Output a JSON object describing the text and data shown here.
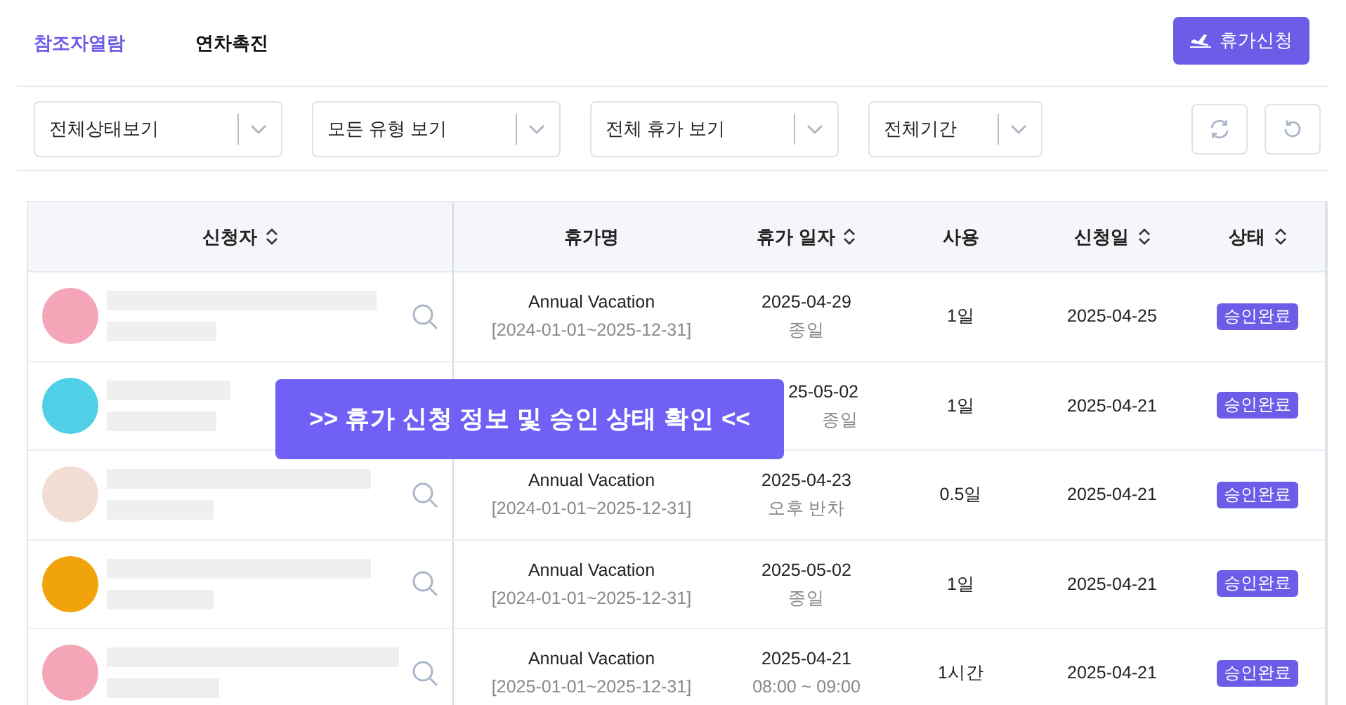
{
  "tabs": [
    {
      "label": "참조자열람",
      "selected": true
    },
    {
      "label": "연차촉진",
      "selected": false
    }
  ],
  "request_button": {
    "label": "휴가신청"
  },
  "filters": [
    {
      "label": "전체상태보기"
    },
    {
      "label": "모든 유형 보기"
    },
    {
      "label": "전체 휴가 보기"
    },
    {
      "label": "전체기간"
    }
  ],
  "table": {
    "columns": [
      {
        "label": "신청자",
        "sortable": true
      },
      {
        "label": "휴가명",
        "sortable": false
      },
      {
        "label": "휴가 일자",
        "sortable": true
      },
      {
        "label": "사용",
        "sortable": false
      },
      {
        "label": "신청일",
        "sortable": true
      },
      {
        "label": "상태",
        "sortable": true
      }
    ],
    "rows": [
      {
        "color": "#f4a6b8",
        "vacation_name": "Annual Vacation",
        "period": "[2024-01-01~2025-12-31]",
        "date": "2025-04-29",
        "date_detail": "종일",
        "usage": "1일",
        "applied_date": "2025-04-25",
        "status": "승인완료"
      },
      {
        "color": "#4fd0e6",
        "date": "25-05-02",
        "date_detail": "종일",
        "usage": "1일",
        "applied_date": "2025-04-21",
        "status": "승인완료"
      },
      {
        "color": "#f1ddd2",
        "vacation_name": "Annual Vacation",
        "period": "[2024-01-01~2025-12-31]",
        "date": "2025-04-23",
        "date_detail": "오후 반차",
        "usage": "0.5일",
        "applied_date": "2025-04-21",
        "status": "승인완료"
      },
      {
        "color": "#f0a30a",
        "vacation_name": "Annual Vacation",
        "period": "[2024-01-01~2025-12-31]",
        "date": "2025-05-02",
        "date_detail": "종일",
        "usage": "1일",
        "applied_date": "2025-04-21",
        "status": "승인완료"
      },
      {
        "color": "#f4a6b8",
        "vacation_name": "Annual Vacation",
        "period": "[2025-01-01~2025-12-31]",
        "date": "2025-04-21",
        "date_detail": "08:00 ~ 09:00",
        "usage": "1시간",
        "applied_date": "2025-04-21",
        "status": "승인완료"
      }
    ]
  },
  "banner": {
    "text": ">> 휴가 신청 정보 및 승인 상태 확인 <<"
  }
}
